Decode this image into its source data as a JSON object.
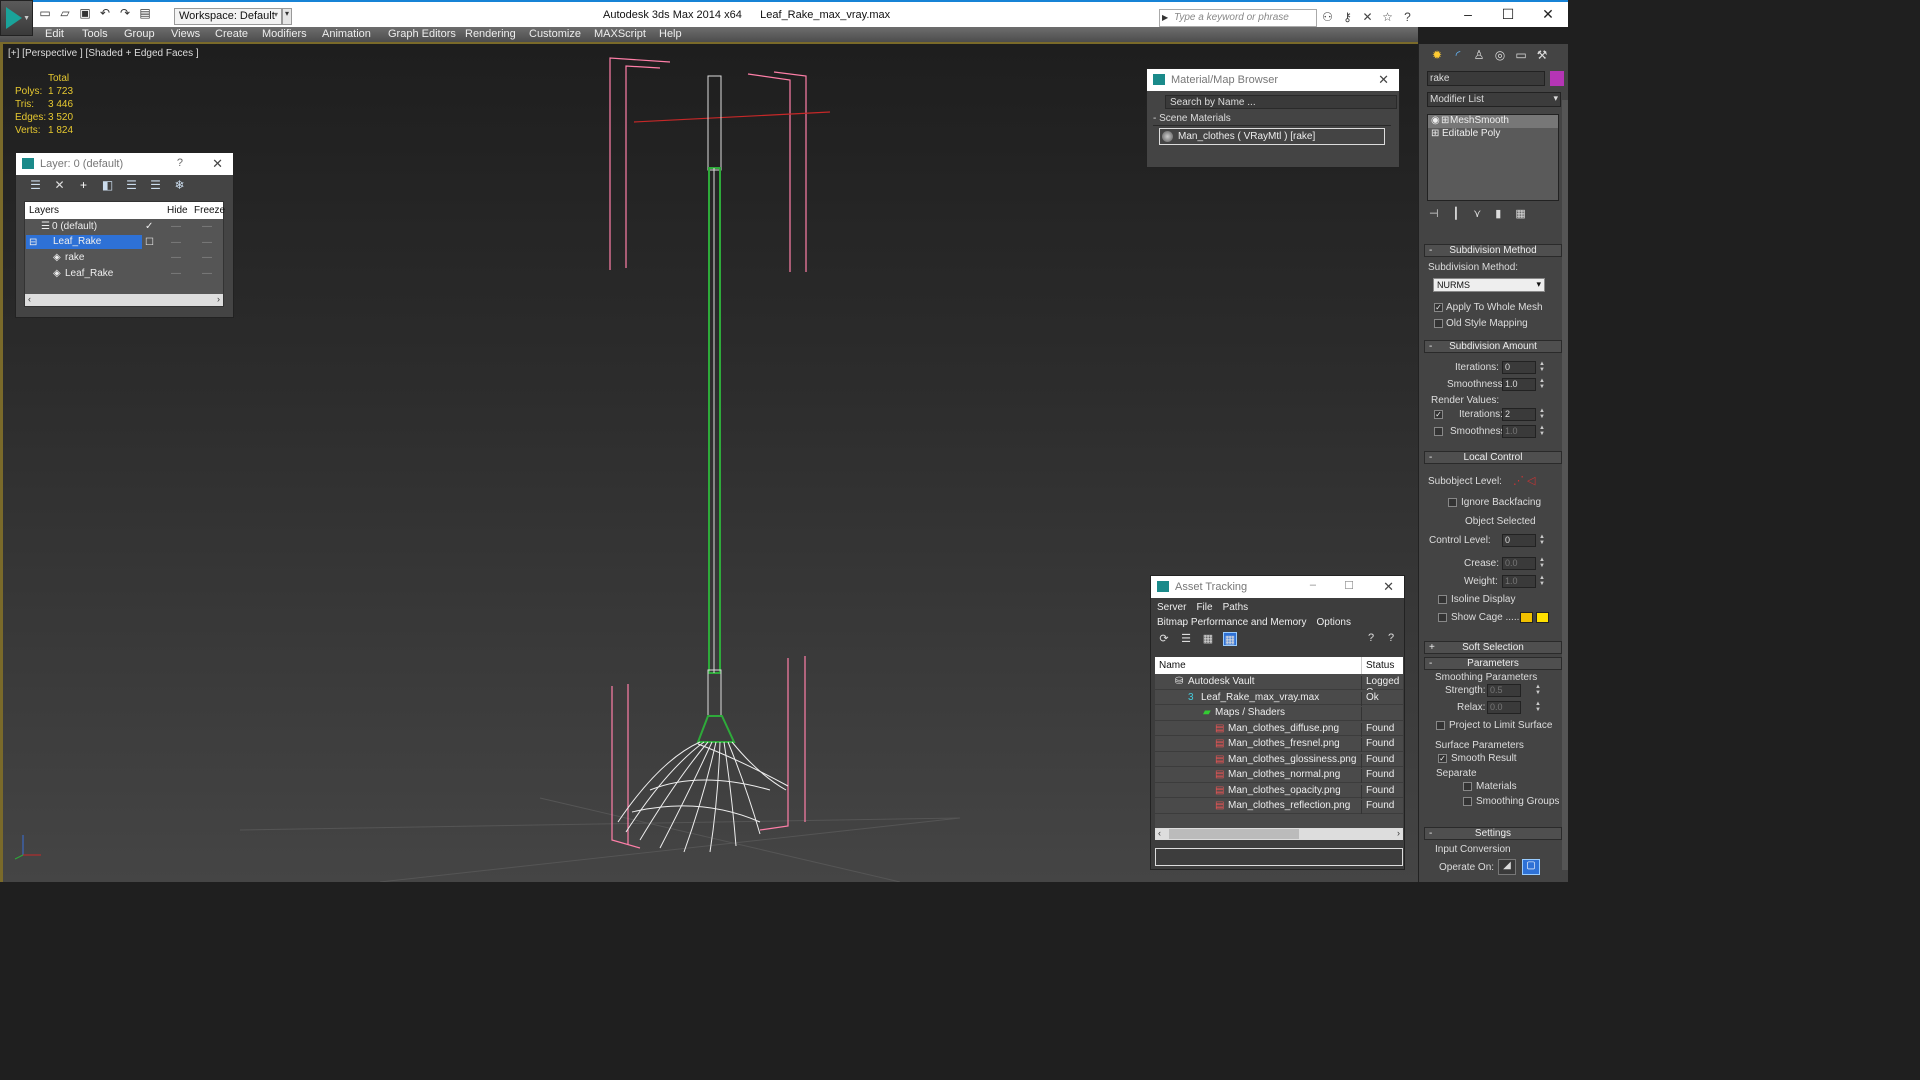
{
  "app": {
    "title": "Autodesk 3ds Max  2014 x64",
    "file": "Leaf_Rake_max_vray.max",
    "workspace": "Workspace: Default",
    "search_placeholder": "Type a keyword or phrase"
  },
  "menu": [
    "Edit",
    "Tools",
    "Group",
    "Views",
    "Create",
    "Modifiers",
    "Animation",
    "Graph Editors",
    "Rendering",
    "Customize",
    "MAXScript",
    "Help"
  ],
  "viewport": {
    "label": "[+] [Perspective ] [Shaded + Edged Faces ]",
    "stats": {
      "header": "Total",
      "rows": [
        {
          "k": "Polys:",
          "v": "1 723"
        },
        {
          "k": "Tris:",
          "v": "3 446"
        },
        {
          "k": "Edges:",
          "v": "3 520"
        },
        {
          "k": "Verts:",
          "v": "1 824"
        }
      ]
    }
  },
  "layer_panel": {
    "title": "Layer: 0 (default)",
    "help": "?",
    "columns": [
      "Layers",
      "Hide",
      "Freeze"
    ],
    "rows": [
      {
        "name": "0 (default)",
        "level": 0,
        "active": true
      },
      {
        "name": "Leaf_Rake",
        "level": 0,
        "selected": true
      },
      {
        "name": "rake",
        "level": 1
      },
      {
        "name": "Leaf_Rake",
        "level": 1
      }
    ]
  },
  "material_browser": {
    "title": "Material/Map Browser",
    "search": "Search by Name ...",
    "group": "Scene Materials",
    "item": "Man_clothes  ( VRayMtl ) [rake]"
  },
  "asset_tracking": {
    "title": "Asset Tracking",
    "menu1": [
      "Server",
      "File",
      "Paths"
    ],
    "menu2": [
      "Bitmap Performance and Memory",
      "Options"
    ],
    "columns": [
      "Name",
      "Status"
    ],
    "rows": [
      {
        "name": "Autodesk Vault",
        "status": "Logged C",
        "level": 1
      },
      {
        "name": "Leaf_Rake_max_vray.max",
        "status": "Ok",
        "level": 2
      },
      {
        "name": "Maps / Shaders",
        "status": "",
        "level": 3
      },
      {
        "name": "Man_clothes_diffuse.png",
        "status": "Found",
        "level": 4
      },
      {
        "name": "Man_clothes_fresnel.png",
        "status": "Found",
        "level": 4
      },
      {
        "name": "Man_clothes_glossiness.png",
        "status": "Found",
        "level": 4
      },
      {
        "name": "Man_clothes_normal.png",
        "status": "Found",
        "level": 4
      },
      {
        "name": "Man_clothes_opacity.png",
        "status": "Found",
        "level": 4
      },
      {
        "name": "Man_clothes_reflection.png",
        "status": "Found",
        "level": 4
      }
    ]
  },
  "command_panel": {
    "object_name": "rake",
    "object_color": "#b535b5",
    "modifier_list": "Modifier List",
    "stack": [
      "MeshSmooth",
      "Editable Poly"
    ],
    "subdivision_method": {
      "title": "Subdivision Method",
      "label": "Subdivision Method:",
      "value": "NURMS",
      "apply_whole": "Apply To Whole Mesh",
      "old_style": "Old Style Mapping"
    },
    "subdivision_amount": {
      "title": "Subdivision Amount",
      "iterations_label": "Iterations:",
      "iterations": "0",
      "smoothness_label": "Smoothness:",
      "smoothness": "1.0",
      "render_values": "Render Values:",
      "r_iterations": "2",
      "r_smoothness": "1.0"
    },
    "local_control": {
      "title": "Local Control",
      "subobject": "Subobject Level:",
      "ignore_backfacing": "Ignore Backfacing",
      "object_selected": "Object Selected",
      "control_level_label": "Control Level:",
      "control_level": "0",
      "crease_label": "Crease:",
      "crease": "0.0",
      "weight_label": "Weight:",
      "weight": "1.0",
      "isoline": "Isoline Display",
      "show_cage": "Show Cage ......"
    },
    "soft_selection": "Soft Selection",
    "parameters": "Parameters",
    "smoothing_params": "Smoothing Parameters",
    "strength_label": "Strength:",
    "strength": "0.5",
    "relax_label": "Relax:",
    "relax": "0.0",
    "project": "Project to Limit Surface",
    "surface_params": "Surface Parameters",
    "smooth_result": "Smooth Result",
    "separate": "Separate",
    "materials": "Materials",
    "smoothing_groups": "Smoothing Groups",
    "settings": "Settings",
    "input_conversion": "Input Conversion",
    "operate_on": "Operate On:"
  }
}
